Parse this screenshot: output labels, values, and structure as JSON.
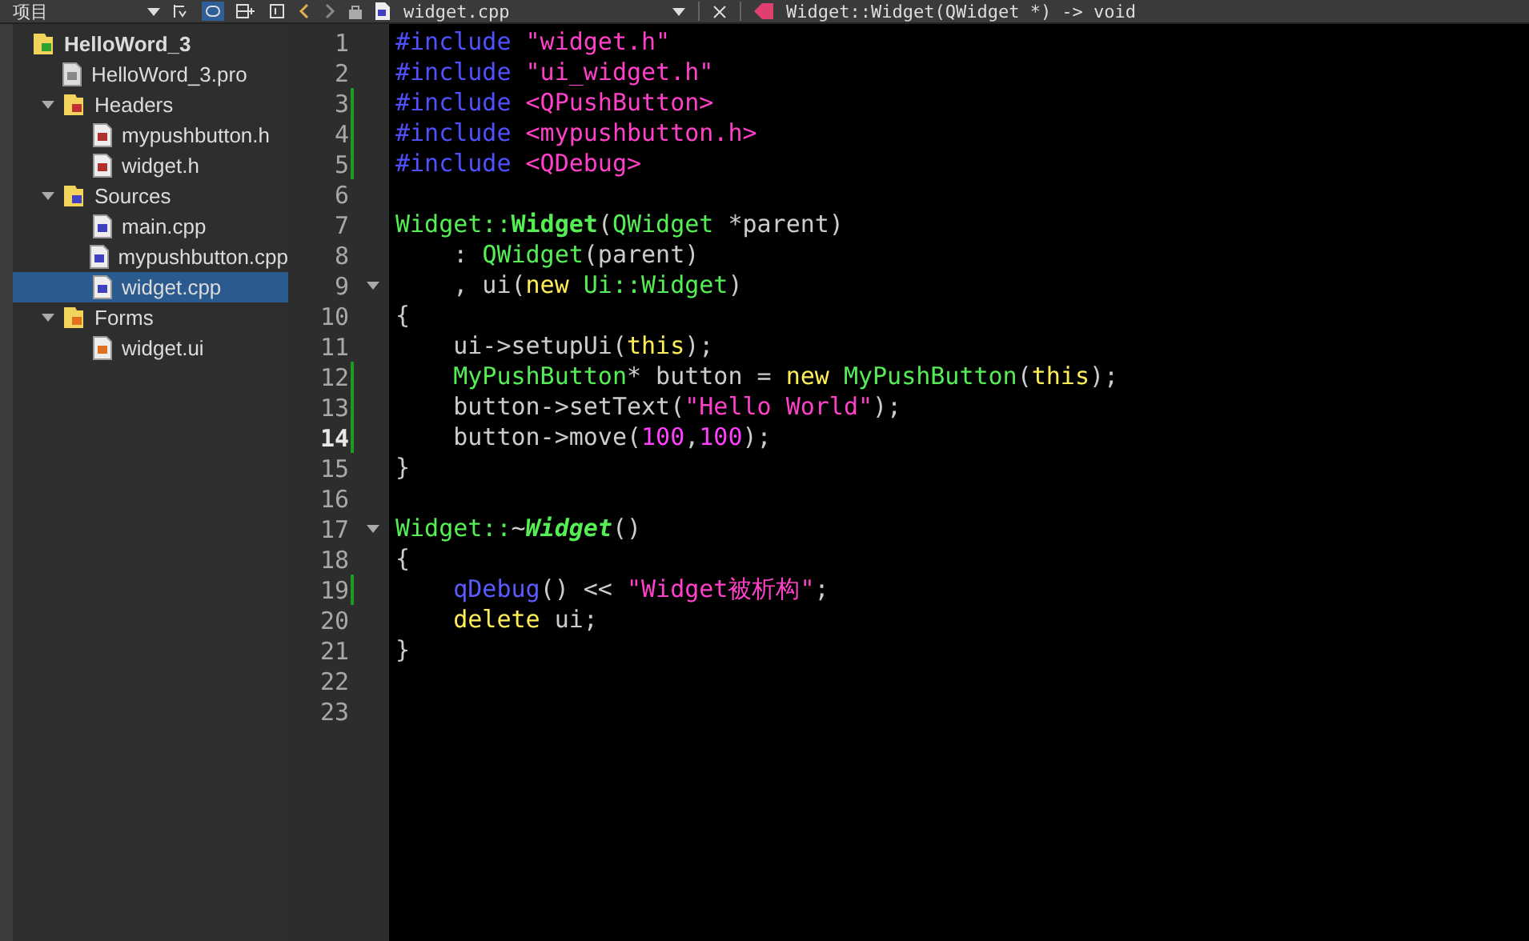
{
  "sidebar": {
    "title": "项目",
    "tree": [
      {
        "label": "HelloWord_3",
        "kind": "project",
        "selected": false,
        "children": [
          {
            "label": "HelloWord_3.pro",
            "kind": "pro",
            "selected": false
          },
          {
            "label": "Headers",
            "kind": "header-folder",
            "expanded": true,
            "selected": false,
            "children": [
              {
                "label": "mypushbutton.h",
                "kind": "header",
                "selected": false
              },
              {
                "label": "widget.h",
                "kind": "header",
                "selected": false
              }
            ]
          },
          {
            "label": "Sources",
            "kind": "source-folder",
            "expanded": true,
            "selected": false,
            "children": [
              {
                "label": "main.cpp",
                "kind": "source",
                "selected": false
              },
              {
                "label": "mypushbutton.cpp",
                "kind": "source",
                "selected": false
              },
              {
                "label": "widget.cpp",
                "kind": "source",
                "selected": true
              }
            ]
          },
          {
            "label": "Forms",
            "kind": "form-folder",
            "expanded": true,
            "selected": false,
            "children": [
              {
                "label": "widget.ui",
                "kind": "form",
                "selected": false
              }
            ]
          }
        ]
      }
    ]
  },
  "editor": {
    "file": "widget.cpp",
    "symbol": "Widget::Widget(QWidget *) -> void",
    "lines": [
      {
        "number": "1",
        "changed": false,
        "fold": false,
        "current": false,
        "tokens": [
          {
            "text": "#include ",
            "kind": "preproc"
          },
          {
            "text": "\"widget.h\"",
            "kind": "string"
          }
        ]
      },
      {
        "number": "2",
        "changed": false,
        "fold": false,
        "current": false,
        "tokens": [
          {
            "text": "#include ",
            "kind": "preproc"
          },
          {
            "text": "\"ui_widget.h\"",
            "kind": "string"
          }
        ]
      },
      {
        "number": "3",
        "changed": true,
        "fold": false,
        "current": false,
        "tokens": [
          {
            "text": "#include ",
            "kind": "preproc"
          },
          {
            "text": "<QPushButton>",
            "kind": "string"
          }
        ]
      },
      {
        "number": "4",
        "changed": true,
        "fold": false,
        "current": false,
        "tokens": [
          {
            "text": "#include ",
            "kind": "preproc"
          },
          {
            "text": "<mypushbutton.h>",
            "kind": "string"
          }
        ]
      },
      {
        "number": "5",
        "changed": true,
        "fold": false,
        "current": false,
        "tokens": [
          {
            "text": "#include ",
            "kind": "preproc"
          },
          {
            "text": "<QDebug>",
            "kind": "string"
          }
        ]
      },
      {
        "number": "6",
        "changed": false,
        "fold": false,
        "current": false
      },
      {
        "number": "7",
        "changed": false,
        "fold": false,
        "current": false,
        "tokens": [
          {
            "text": "Widget::",
            "kind": "type"
          },
          {
            "text": "Widget",
            "kind": "decl"
          },
          {
            "text": "(",
            "kind": "plain"
          },
          {
            "text": "QWidget",
            "kind": "type"
          },
          {
            "text": " *parent)",
            "kind": "plain"
          }
        ]
      },
      {
        "number": "8",
        "changed": false,
        "fold": false,
        "current": false,
        "tokens": [
          {
            "text": "    : ",
            "kind": "plain"
          },
          {
            "text": "QWidget",
            "kind": "type"
          },
          {
            "text": "(parent)",
            "kind": "plain"
          }
        ]
      },
      {
        "number": "9",
        "changed": false,
        "fold": true,
        "current": false,
        "tokens": [
          {
            "text": "    , ui(",
            "kind": "plain"
          },
          {
            "text": "new",
            "kind": "keyword"
          },
          {
            "text": " Ui::Widget",
            "kind": "type"
          },
          {
            "text": ")",
            "kind": "plain"
          }
        ]
      },
      {
        "number": "10",
        "changed": false,
        "fold": false,
        "current": false,
        "tokens": [
          {
            "text": "{",
            "kind": "plain"
          }
        ]
      },
      {
        "number": "11",
        "changed": false,
        "fold": false,
        "current": false,
        "tokens": [
          {
            "text": "    ui->setupUi(",
            "kind": "plain"
          },
          {
            "text": "this",
            "kind": "keyword"
          },
          {
            "text": ");",
            "kind": "plain"
          }
        ]
      },
      {
        "number": "12",
        "changed": true,
        "fold": false,
        "current": false,
        "tokens": [
          {
            "text": "    MyPushButton",
            "kind": "type"
          },
          {
            "text": "* button = ",
            "kind": "plain"
          },
          {
            "text": "new",
            "kind": "keyword"
          },
          {
            "text": " MyPushButton",
            "kind": "type"
          },
          {
            "text": "(",
            "kind": "plain"
          },
          {
            "text": "this",
            "kind": "keyword"
          },
          {
            "text": ");",
            "kind": "plain"
          }
        ]
      },
      {
        "number": "13",
        "changed": true,
        "fold": false,
        "current": false,
        "tokens": [
          {
            "text": "    button->setText(",
            "kind": "plain"
          },
          {
            "text": "\"Hello World\"",
            "kind": "string"
          },
          {
            "text": ");",
            "kind": "plain"
          }
        ]
      },
      {
        "number": "14",
        "changed": true,
        "fold": false,
        "current": true,
        "tokens": [
          {
            "text": "    button->move(",
            "kind": "plain"
          },
          {
            "text": "100",
            "kind": "number"
          },
          {
            "text": ",",
            "kind": "plain"
          },
          {
            "text": "100",
            "kind": "number"
          },
          {
            "text": ");",
            "kind": "plain"
          }
        ]
      },
      {
        "number": "15",
        "changed": false,
        "fold": false,
        "current": false,
        "tokens": [
          {
            "text": "}",
            "kind": "plain"
          }
        ]
      },
      {
        "number": "16",
        "changed": false,
        "fold": false,
        "current": false
      },
      {
        "number": "17",
        "changed": false,
        "fold": true,
        "current": false,
        "tokens": [
          {
            "text": "Widget::",
            "kind": "type"
          },
          {
            "text": "~",
            "kind": "plain"
          },
          {
            "text": "Widget",
            "kind": "dtor"
          },
          {
            "text": "()",
            "kind": "plain"
          }
        ]
      },
      {
        "number": "18",
        "changed": false,
        "fold": false,
        "current": false,
        "tokens": [
          {
            "text": "{",
            "kind": "plain"
          }
        ]
      },
      {
        "number": "19",
        "changed": true,
        "fold": false,
        "current": false,
        "tokens": [
          {
            "text": "    qDebug",
            "kind": "func"
          },
          {
            "text": "() << ",
            "kind": "plain"
          },
          {
            "text": "\"Widget被析构\"",
            "kind": "string"
          },
          {
            "text": ";",
            "kind": "plain"
          }
        ]
      },
      {
        "number": "20",
        "changed": false,
        "fold": false,
        "current": false,
        "tokens": [
          {
            "text": "    delete",
            "kind": "keyword"
          },
          {
            "text": " ui;",
            "kind": "plain"
          }
        ]
      },
      {
        "number": "21",
        "changed": false,
        "fold": false,
        "current": false,
        "tokens": [
          {
            "text": "}",
            "kind": "plain"
          }
        ]
      },
      {
        "number": "22",
        "changed": false,
        "fold": false,
        "current": false
      },
      {
        "number": "23",
        "changed": false,
        "fold": false,
        "current": false
      }
    ]
  }
}
